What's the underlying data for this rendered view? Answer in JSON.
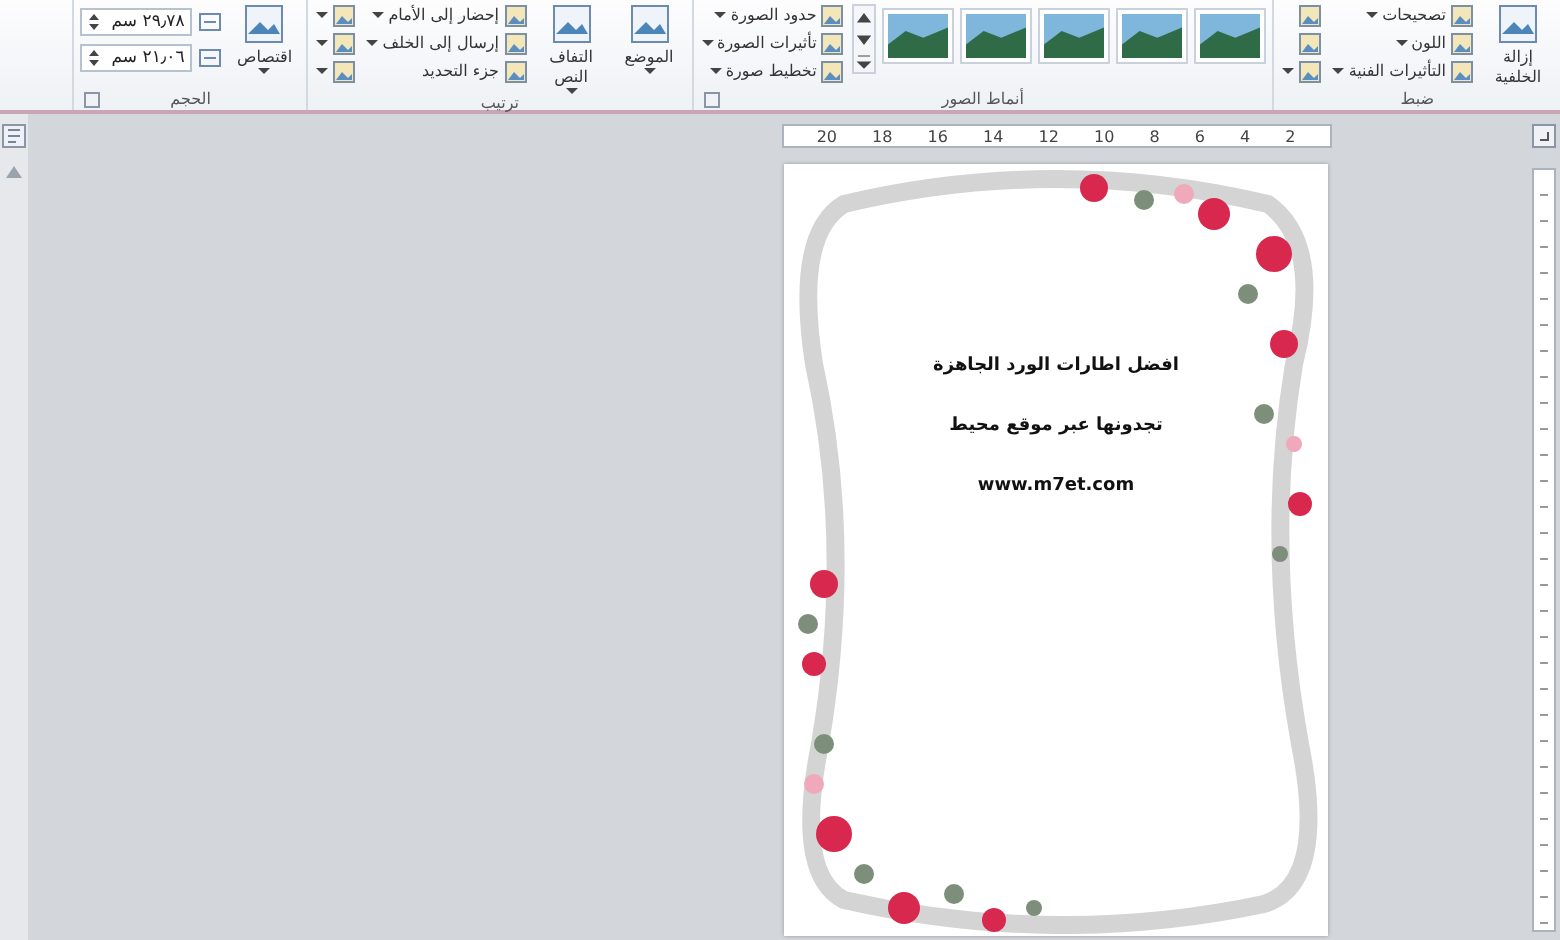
{
  "ribbon": {
    "groups": [
      {
        "label": "ضبط",
        "launcher": false,
        "columns": [
          [
            {
              "kind": "large",
              "label": "إزالة الخلفية"
            }
          ],
          [
            {
              "kind": "small",
              "label": "تصحيحات",
              "dropdown": true
            },
            {
              "kind": "small",
              "label": "اللون",
              "dropdown": true
            },
            {
              "kind": "small",
              "label": "التأثيرات الفنية",
              "dropdown": true
            }
          ],
          [
            {
              "kind": "small",
              "dropdown": false
            },
            {
              "kind": "small",
              "dropdown": false
            },
            {
              "kind": "small",
              "dropdown": true
            }
          ]
        ]
      },
      {
        "label": "أنماط الصور",
        "launcher": true,
        "columns": [
          [
            {
              "kind": "style"
            }
          ],
          [
            {
              "kind": "style"
            }
          ],
          [
            {
              "kind": "style"
            }
          ],
          [
            {
              "kind": "style"
            }
          ],
          [
            {
              "kind": "style"
            }
          ],
          [
            {
              "kind": "scroll"
            }
          ],
          [
            {
              "kind": "small",
              "label": "حدود الصورة",
              "dropdown": true
            },
            {
              "kind": "small",
              "label": "تأثيرات الصورة",
              "dropdown": true
            },
            {
              "kind": "small",
              "label": "تخطيط صورة",
              "dropdown": true
            }
          ]
        ]
      },
      {
        "label": "ترتيب",
        "launcher": false,
        "columns": [
          [
            {
              "kind": "large",
              "label": "الموضع",
              "dropdown": true
            }
          ],
          [
            {
              "kind": "large",
              "label": "التفاف النص",
              "dropdown": true
            }
          ],
          [
            {
              "kind": "small",
              "label": "إحضار إلى الأمام",
              "dropdown": true
            },
            {
              "kind": "small",
              "label": "إرسال إلى الخلف",
              "dropdown": true
            },
            {
              "kind": "small",
              "label": "جزء التحديد",
              "dropdown": false
            }
          ],
          [
            {
              "kind": "small",
              "dropdown": true
            },
            {
              "kind": "small",
              "dropdown": true
            },
            {
              "kind": "small",
              "dropdown": true
            }
          ]
        ]
      },
      {
        "label": "الحجم",
        "launcher": true,
        "columns": [
          [
            {
              "kind": "large",
              "label": "اقتصاص",
              "dropdown": true
            }
          ],
          [
            {
              "kind": "spin",
              "value": "٢٩٫٧٨ سم"
            },
            {
              "kind": "spin",
              "value": "٢١٫٠٦ سم"
            }
          ]
        ]
      }
    ]
  },
  "ruler": {
    "labels": [
      "2",
      "4",
      "6",
      "8",
      "10",
      "12",
      "14",
      "16",
      "18",
      "20"
    ]
  },
  "page": {
    "lines": [
      {
        "text": "افضل اطارات الورد الجاهزة"
      },
      {
        "text": "تجدونها عبر موقع محيط"
      },
      {
        "text": "www.m7et.com"
      }
    ]
  }
}
